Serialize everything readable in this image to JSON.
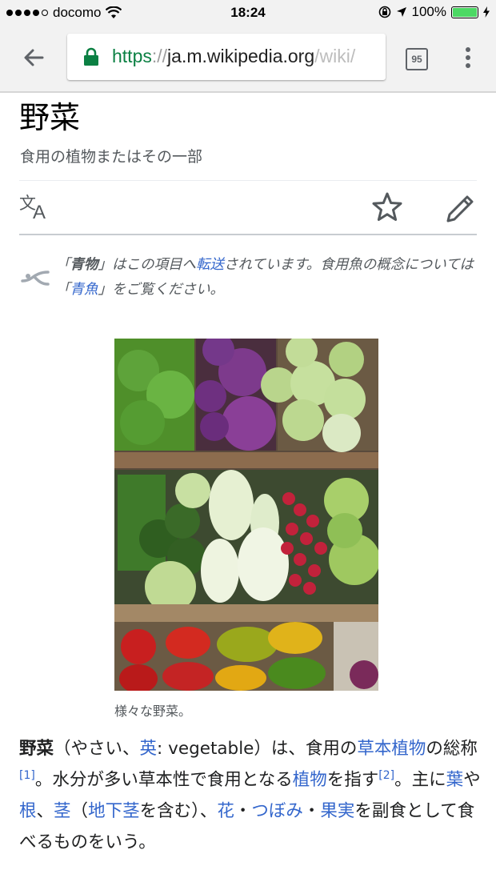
{
  "status_bar": {
    "carrier": "docomo",
    "time": "18:24",
    "battery": "100%",
    "battery_level": 1.0
  },
  "toolbar": {
    "url_scheme": "https",
    "url_sep": "://",
    "url_host": "ja.m.wikipedia.org",
    "url_path": "/wiki/",
    "tab_count": "95",
    "icons": [
      "back-arrow-icon",
      "lock-icon",
      "tabs-icon",
      "menu-icon"
    ]
  },
  "page": {
    "title": "野菜",
    "subtitle": "食用の植物またはその一部",
    "action_icons": [
      "language-icon",
      "star-icon",
      "edit-icon"
    ]
  },
  "hatnote": {
    "q_open": "「",
    "term": "青物",
    "q_close": "」",
    "text1": "はこの項目へ",
    "link_redirect": "転送",
    "text2": "されています。食用魚の概念については",
    "q2_open": "「",
    "link_fish": "青魚",
    "q2_close": "」",
    "text3": "をご覧ください。"
  },
  "figure": {
    "caption": "様々な野菜。"
  },
  "article": {
    "bold_term": "野菜",
    "t1": "（やさい、",
    "link_en": "英",
    "t2": ": vegetable）は、食用の",
    "link_herb": "草本植物",
    "t3": "の総称",
    "ref1": "[1]",
    "t4": "。水分が多い草本性で食用となる",
    "link_plant": "植物",
    "t5": "を指す",
    "ref2": "[2]",
    "t6": "。主に",
    "link_leaf": "葉",
    "t7": "や",
    "link_root": "根",
    "t8": "、",
    "link_stem": "茎",
    "t9": "（",
    "link_underground": "地下茎",
    "t10": "を含む）、",
    "link_flower": "花",
    "t11": "・",
    "link_bud": "つぼみ",
    "t12": "・",
    "link_fruit": "果実",
    "t13": "を副食として食べるものをいう。"
  },
  "colors": {
    "link": "#3366cc",
    "secure": "#0b8043",
    "battery": "#4cd964"
  }
}
